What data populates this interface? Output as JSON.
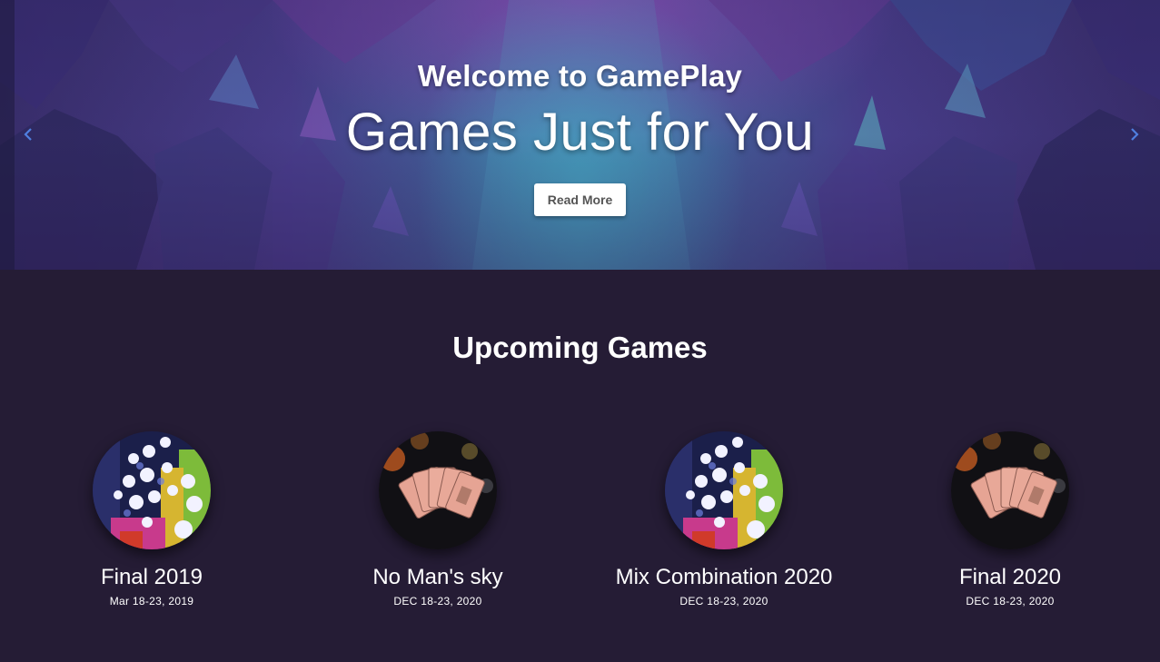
{
  "hero": {
    "subtitle": "Welcome to GamePlay",
    "title": "Games Just for You",
    "button_label": "Read More",
    "prev_icon": "chevron-left-icon",
    "next_icon": "chevron-right-icon",
    "arrow_color": "#4f7fe0"
  },
  "upcoming": {
    "heading": "Upcoming Games",
    "games": [
      {
        "name": "Final 2019",
        "date": "Mar 18-23, 2019",
        "image": "casino-chips"
      },
      {
        "name": "No Man's sky",
        "date": "DEC 18-23, 2020",
        "image": "playing-cards"
      },
      {
        "name": "Mix Combination 2020",
        "date": "DEC 18-23, 2020",
        "image": "casino-chips"
      },
      {
        "name": "Final 2020",
        "date": "DEC 18-23, 2020",
        "image": "playing-cards"
      }
    ]
  },
  "colors": {
    "page_background": "#251c35",
    "button_background": "#ffffff",
    "button_text": "#555555"
  }
}
